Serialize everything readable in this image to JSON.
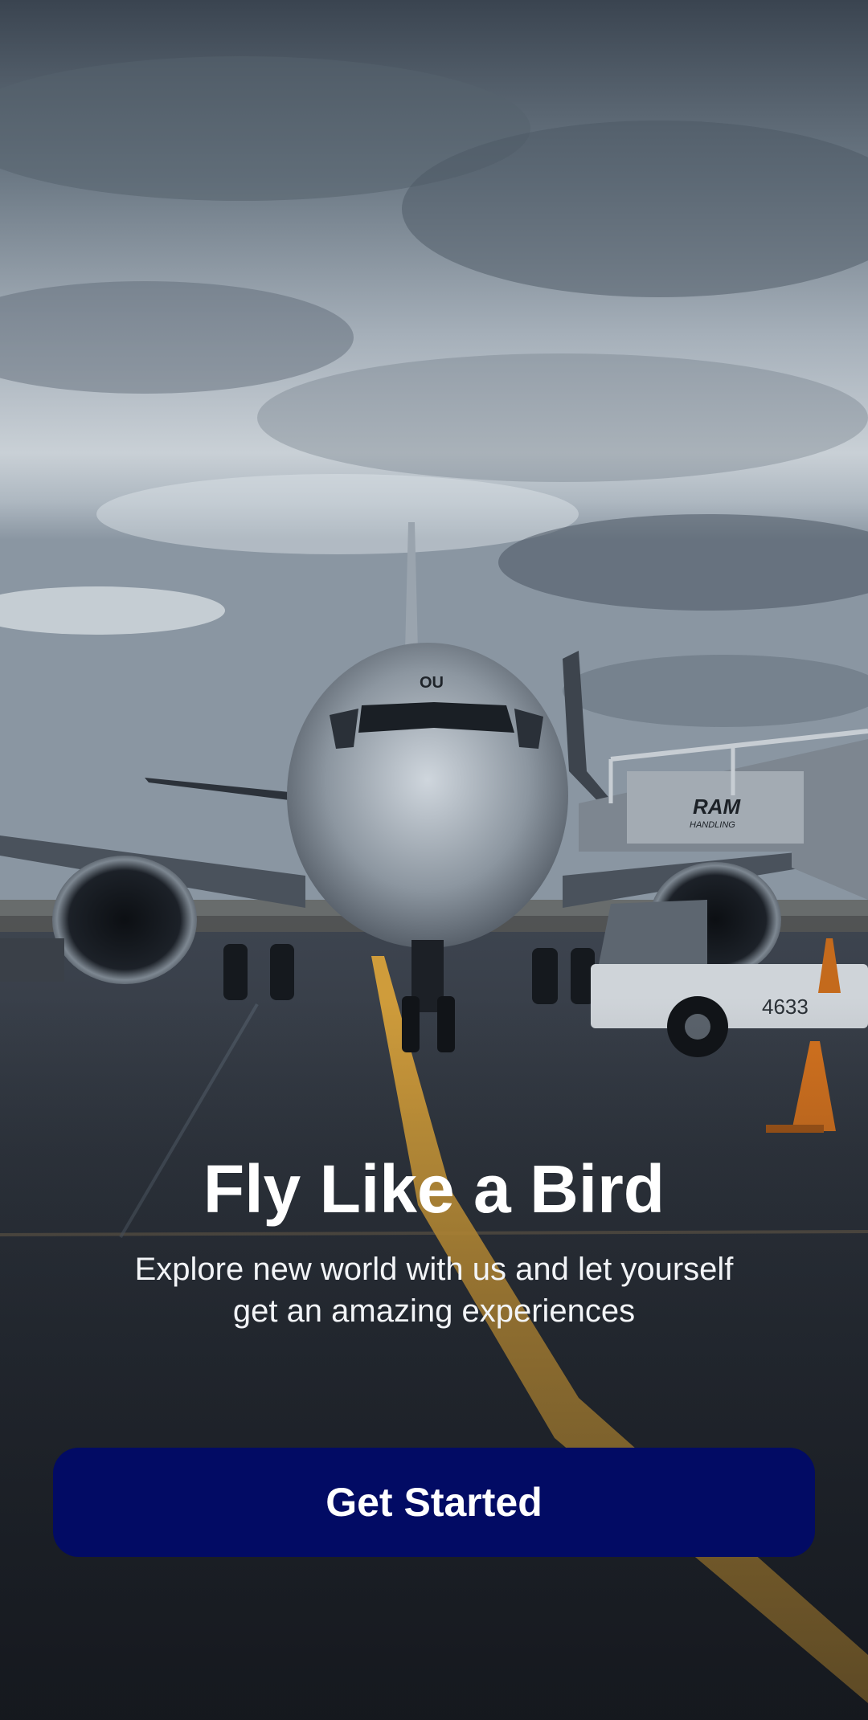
{
  "screen": {
    "background_image": "airplane-on-tarmac-photo",
    "title": "Fly Like a Bird",
    "subtitle": "Explore new world with us and let yourself get an amazing experiences",
    "cta_label": "Get Started"
  },
  "colors": {
    "cta_background": "#020b64",
    "text": "#ffffff",
    "runway_line": "#e0a63a"
  },
  "scene_text": {
    "stairs_logo": "RAM",
    "stairs_logo_sub": "HANDLING",
    "vehicle_number": "4633",
    "aircraft_nose": "OU"
  }
}
